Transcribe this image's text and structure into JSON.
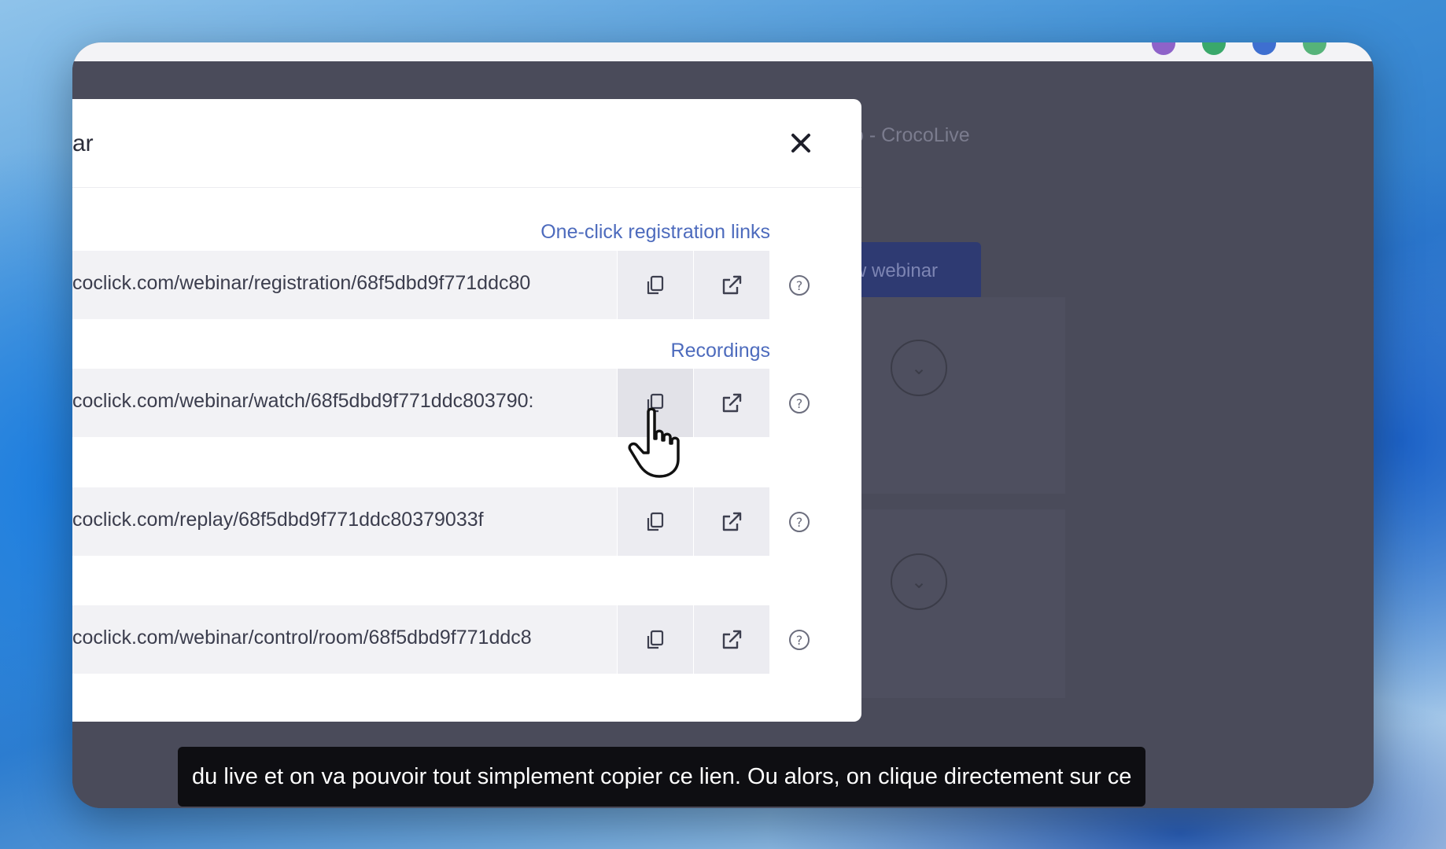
{
  "background_page": {
    "title_fragment": "o - CrocoLive",
    "button_fragment": "w webinar"
  },
  "modal": {
    "title_fragment": "ar",
    "close_icon": "close-icon",
    "section_links": {
      "registration": "One-click registration links",
      "recordings": "Recordings"
    },
    "rows": [
      {
        "url": "coclick.com/webinar/registration/68f5dbd9f771ddc80",
        "copy_icon": "copy-icon",
        "open_icon": "external-link-icon",
        "help_icon": "help-circle-icon"
      },
      {
        "url": "coclick.com/webinar/watch/68f5dbd9f771ddc803790:",
        "copy_icon": "copy-icon",
        "open_icon": "external-link-icon",
        "help_icon": "help-circle-icon"
      },
      {
        "url": "coclick.com/replay/68f5dbd9f771ddc80379033f",
        "copy_icon": "copy-icon",
        "open_icon": "external-link-icon",
        "help_icon": "help-circle-icon"
      },
      {
        "url": "coclick.com/webinar/control/room/68f5dbd9f771ddc8",
        "copy_icon": "copy-icon",
        "open_icon": "external-link-icon",
        "help_icon": "help-circle-icon"
      }
    ]
  },
  "subtitle": "du live et on va pouvoir tout simplement copier ce lien. Ou alors, on clique directement sur ce",
  "colors": {
    "link": "#4d6bbd",
    "overlay": "#4a4b5a",
    "button_bg": "#2e3a72",
    "subtitle_bg": "#0e0e12"
  }
}
